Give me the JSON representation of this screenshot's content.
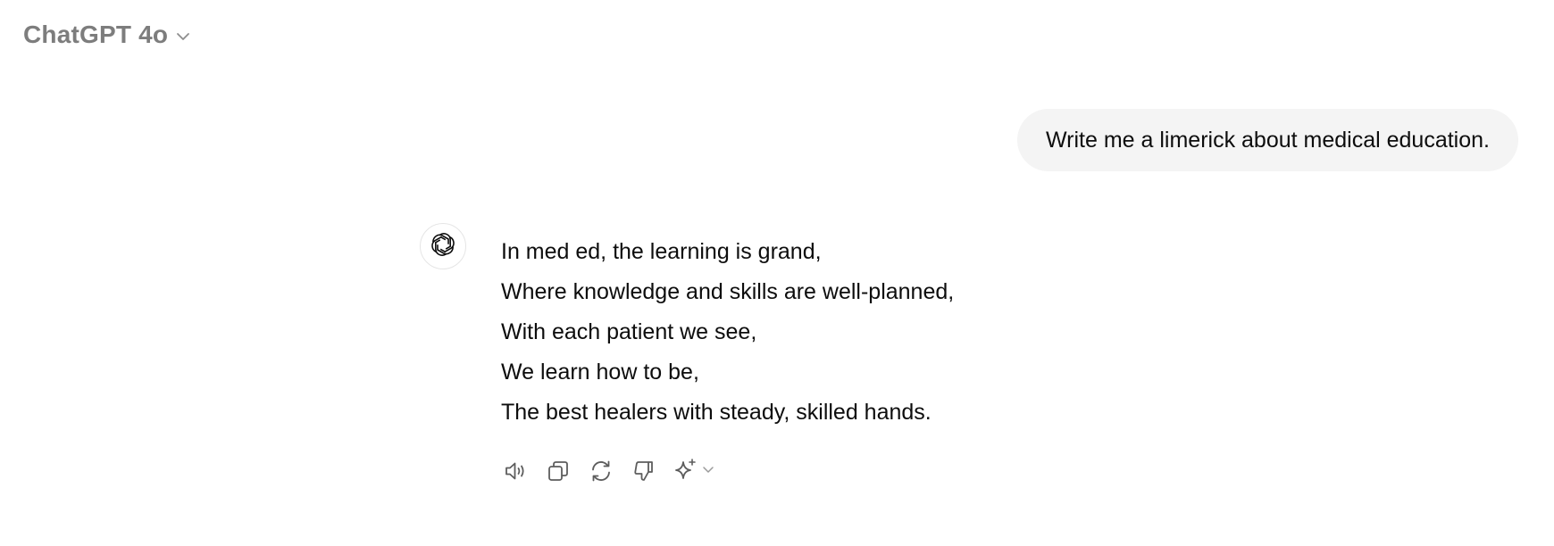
{
  "header": {
    "model_name": "ChatGPT 4o",
    "chevron_icon": "chevron-down-icon"
  },
  "conversation": {
    "user_message": "Write me a limerick about medical education.",
    "assistant": {
      "avatar_icon": "openai-logo-icon",
      "lines": [
        "In med ed, the learning is grand,",
        "Where knowledge and skills are well-planned,",
        "With each patient we see,",
        "We learn how to be,",
        "The best healers with steady, skilled hands."
      ]
    },
    "actions": [
      {
        "name": "read-aloud",
        "icon": "speaker-icon"
      },
      {
        "name": "copy",
        "icon": "copy-icon"
      },
      {
        "name": "regenerate",
        "icon": "refresh-icon"
      },
      {
        "name": "bad-response",
        "icon": "thumbs-down-icon"
      },
      {
        "name": "switch-model",
        "icon": "sparkle-icon"
      }
    ]
  },
  "colors": {
    "model_name": "#7d7d7d",
    "user_bubble_bg": "#f4f4f4",
    "text": "#0d0d0d",
    "icon": "#5d5d5d"
  }
}
